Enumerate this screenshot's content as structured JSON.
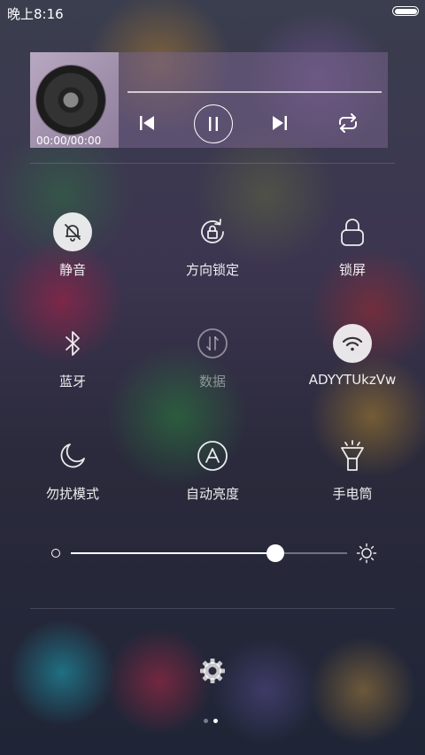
{
  "status_bar": {
    "time": "晚上8:16",
    "battery_level": 1.0
  },
  "music": {
    "time_display": "00:00/00:00",
    "progress": 0
  },
  "toggles": [
    {
      "label": "静音",
      "icon": "bell-off-icon",
      "active": true
    },
    {
      "label": "方向锁定",
      "icon": "rotation-lock-icon",
      "active": false
    },
    {
      "label": "锁屏",
      "icon": "lock-icon",
      "active": false
    },
    {
      "label": "蓝牙",
      "icon": "bluetooth-icon",
      "active": false
    },
    {
      "label": "数据",
      "icon": "mobile-data-icon",
      "active": false,
      "disabled": true
    },
    {
      "label": "ADYYTUkzVw",
      "icon": "wifi-icon",
      "active": true
    },
    {
      "label": "勿扰模式",
      "icon": "moon-icon",
      "active": false
    },
    {
      "label": "自动亮度",
      "icon": "auto-brightness-icon",
      "active": false
    },
    {
      "label": "手电筒",
      "icon": "flashlight-icon",
      "active": false
    }
  ],
  "brightness": {
    "level": 0.74
  },
  "pager": {
    "count": 2,
    "current": 2
  }
}
